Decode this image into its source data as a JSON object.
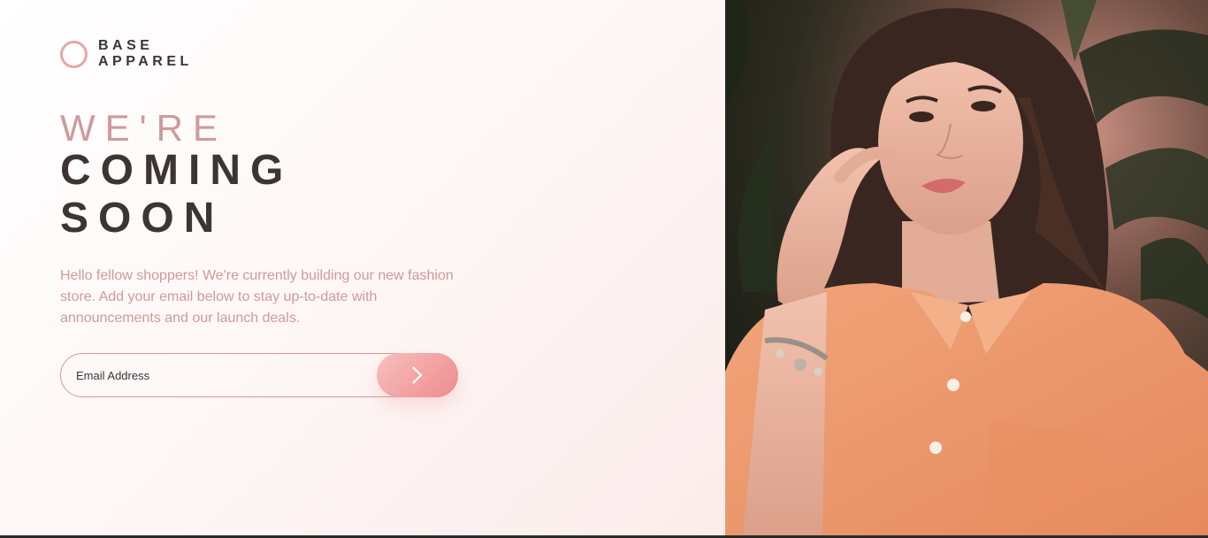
{
  "brand": {
    "line1": "BASE",
    "line2": "APPAREL",
    "accent_color": "#e8a6a6"
  },
  "headline": {
    "light": "WE'RE",
    "line2": "COMING",
    "line3": "SOON"
  },
  "intro_text": "Hello fellow shoppers! We're currently building our new fashion store. Add your email below to stay up-to-date with announcements and our launch deals.",
  "email_form": {
    "placeholder": "Email Address",
    "submit_icon": "chevron-right-icon"
  },
  "hero_image": {
    "subject": "woman in peach shirt with bracelet"
  },
  "colors": {
    "primary_text": "#3d3434",
    "desaturated_red": "#cf9a9a",
    "gradient_start": "#f8bfbf",
    "gradient_end": "#ee8b8b"
  }
}
